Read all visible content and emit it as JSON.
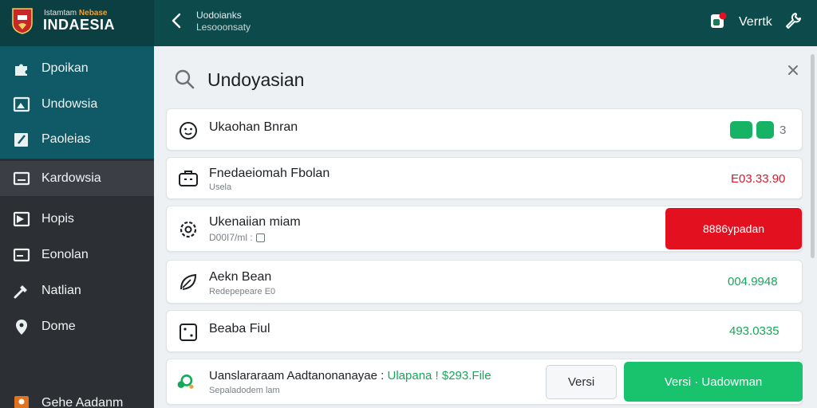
{
  "brand": {
    "small_text": "Istamtam",
    "small_accent": "Nebase",
    "name": "INDAESIA"
  },
  "header": {
    "title": "Uodoianks",
    "subtitle": "Lesooonsaty",
    "user_name": "Verrtk"
  },
  "sidebar": {
    "items": [
      {
        "label": "Dpoikan",
        "icon": "puzzle-icon"
      },
      {
        "label": "Undowsia",
        "icon": "image-icon"
      },
      {
        "label": "Paoleias",
        "icon": "edit-icon"
      },
      {
        "label": "Kardowsia",
        "icon": "monitor-icon"
      },
      {
        "label": "Hopis",
        "icon": "flag-icon"
      },
      {
        "label": "Eonolan",
        "icon": "card-icon"
      },
      {
        "label": "Natlian",
        "icon": "tools-icon"
      },
      {
        "label": "Dome",
        "icon": "location-pin-icon"
      },
      {
        "label": "Gehe Aadanm",
        "icon": "profile-icon"
      }
    ]
  },
  "search": {
    "value": "Undoyasian"
  },
  "list": {
    "items": [
      {
        "title": "Ukaohan Bnran",
        "subtitle": "",
        "icon": "face-icon",
        "extra": "3"
      },
      {
        "title": "Fnedaeiomah Fbolan",
        "subtitle": "Usela",
        "icon": "briefcase-icon",
        "amount": "E03.33.90",
        "amount_color": "#d8182c"
      },
      {
        "title": "Ukenaiian miam",
        "subtitle": "D00I7/ml :",
        "icon": "gear-icon",
        "action_label": "8886ypadan"
      },
      {
        "title": "Aekn Bean",
        "subtitle": "Redepepeare E0",
        "icon": "leaf-icon",
        "amount": "004.9948",
        "amount_color": "#16a85a"
      },
      {
        "title": "Beaba Fiul",
        "subtitle": "",
        "icon": "dice-icon",
        "amount": "493.0335",
        "amount_color": "#16a85a"
      }
    ]
  },
  "footer_card": {
    "title_prefix": "Uanslararaam Aadtanonanayae :",
    "title_highlight": " Ulapana ! $293.File",
    "subtitle": "Sepaladodem lam",
    "icon": "coins-icon",
    "secondary_button": "Versi",
    "primary_button": "Versi · Uadowman"
  },
  "colors": {
    "topbar": "#0d4a4c",
    "sidebar_top": "#0f5a66",
    "sidebar": "#2c2f33",
    "danger": "#e3101f",
    "success": "#19c36e"
  }
}
